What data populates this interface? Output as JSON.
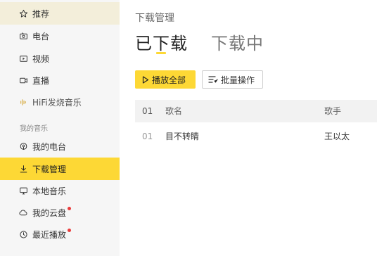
{
  "sidebar": {
    "items": [
      {
        "label": "推荐",
        "icon": "star-icon"
      },
      {
        "label": "电台",
        "icon": "radio-icon"
      },
      {
        "label": "视频",
        "icon": "video-icon"
      },
      {
        "label": "直播",
        "icon": "live-icon"
      },
      {
        "label": "HiFi发烧音乐",
        "icon": "hifi-icon"
      }
    ],
    "section_title": "我的音乐",
    "my_items": [
      {
        "label": "我的电台",
        "icon": "podcast-icon"
      },
      {
        "label": "下载管理",
        "icon": "download-icon"
      },
      {
        "label": "本地音乐",
        "icon": "monitor-icon"
      },
      {
        "label": "我的云盘",
        "icon": "cloud-icon"
      },
      {
        "label": "最近播放",
        "icon": "clock-icon"
      }
    ]
  },
  "main": {
    "breadcrumb": "下载管理",
    "tabs": [
      {
        "label": "已下载"
      },
      {
        "label": "下载中"
      }
    ],
    "buttons": {
      "play_all": "播放全部",
      "batch": "批量操作"
    },
    "table": {
      "header": {
        "index": "01",
        "song": "歌名",
        "artist": "歌手"
      },
      "rows": [
        {
          "index": "01",
          "song": "目不转睛",
          "artist": "王以太"
        }
      ]
    }
  },
  "colors": {
    "accent": "#fdd835",
    "sidebar_bg": "#f6f6f6",
    "highlight_bg": "#f3eeda",
    "notify_dot": "#ea3b3b"
  }
}
